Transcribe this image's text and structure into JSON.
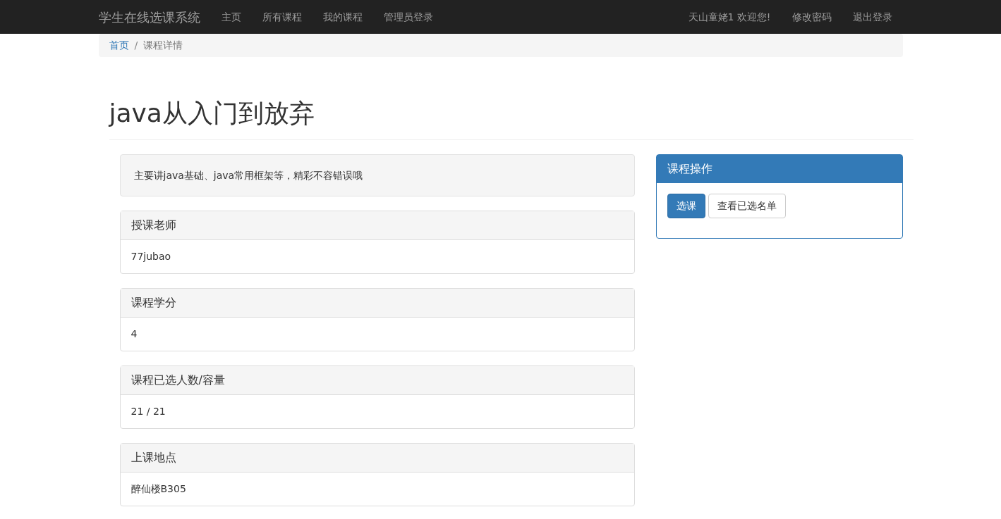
{
  "navbar": {
    "brand": "学生在线选课系统",
    "links": [
      "主页",
      "所有课程",
      "我的课程",
      "管理员登录"
    ],
    "right_links": [
      "天山童姥1 欢迎您!",
      "修改密码",
      "退出登录"
    ]
  },
  "breadcrumb_separator": "/",
  "breadcrumb": [
    {
      "label": "首页",
      "active": false
    },
    {
      "label": "课程详情",
      "active": true
    }
  ],
  "title": "java从入门到放弃",
  "description": "主要讲java基础、java常用框架等，精彩不容错误哦",
  "panels": [
    {
      "heading": "授课老师",
      "body": "77jubao"
    },
    {
      "heading": "课程学分",
      "body": "4"
    },
    {
      "heading": "课程已选人数/容量",
      "body": "21 / 21"
    },
    {
      "heading": "上课地点",
      "body": "醉仙楼B305"
    }
  ],
  "actions": {
    "heading": "课程操作",
    "buttons": [
      {
        "label": "选课",
        "kind": "primary"
      },
      {
        "label": "查看已选名单",
        "kind": "default"
      }
    ]
  }
}
